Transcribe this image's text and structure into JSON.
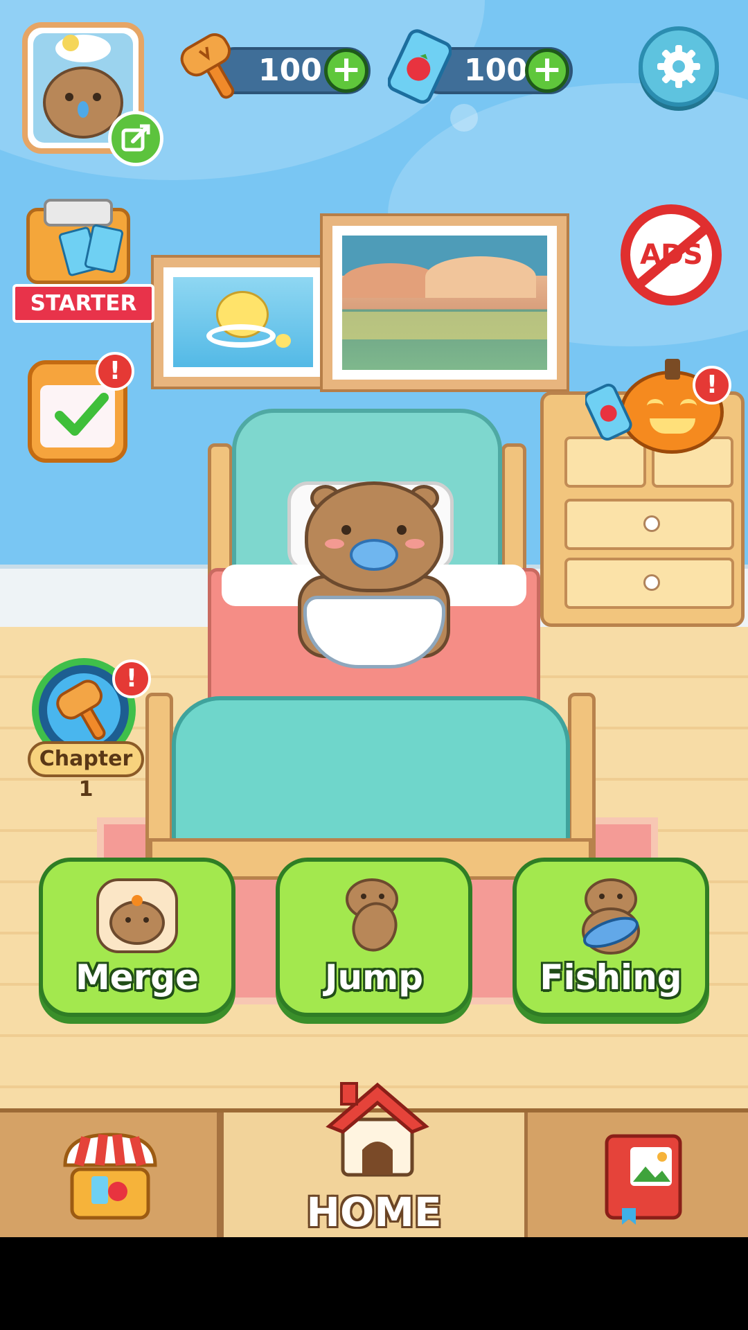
{
  "hud": {
    "hammer_count": "100",
    "ticket_count": "100",
    "plus_symbol": "+",
    "badge_symbol": "!"
  },
  "side_buttons": {
    "starter_label": "STARTER",
    "ads_label": "ADS",
    "chapter_label": "Chapter 1"
  },
  "modes": [
    {
      "label": "Merge"
    },
    {
      "label": "Jump"
    },
    {
      "label": "Fishing"
    }
  ],
  "nav": {
    "home_label": "HOME"
  },
  "icons": {
    "settings": "gear-icon",
    "edit": "edit-icon",
    "shop": "shop-icon",
    "album": "album-icon",
    "home": "house-icon"
  },
  "colors": {
    "wall": "#79c6f3",
    "mode_button": "#a3e84e",
    "currency_pill": "#3f6e98",
    "alert": "#e53935"
  }
}
